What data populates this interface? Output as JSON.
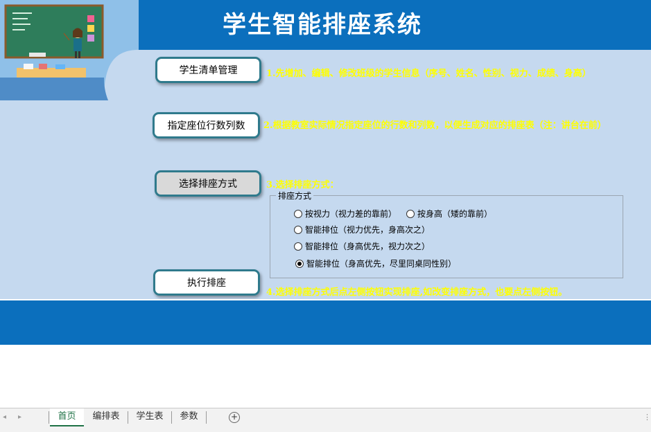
{
  "header": {
    "title": "学生智能排座系统"
  },
  "buttons": {
    "students": "学生清单管理",
    "seats": "指定座位行数列数",
    "method": "选择排座方式",
    "execute": "执行排座"
  },
  "steps": {
    "s1": "1.先增加、编辑、修改班级的学生信息（序号、姓名、性别、视力、成绩、身高）",
    "s2": "2.根据教室实际情况指定座位的行数和列数，以便生成对应的排座表（注：讲台在前）",
    "s3": "3.选择排座方式：",
    "s4": "4.选择排座方式后点左侧按钮实现排座,如改变排座方式，也要点左侧按钮。"
  },
  "seating": {
    "legend": "排座方式",
    "options": [
      {
        "label": "按视力（视力差的靠前）",
        "selected": false
      },
      {
        "label": "按身高（矮的靠前）",
        "selected": false
      },
      {
        "label": "智能排位（视力优先，身高次之）",
        "selected": false
      },
      {
        "label": "智能排位（身高优先，视力次之）",
        "selected": false
      },
      {
        "label": "智能排位（身高优先，尽里同桌同性别）",
        "selected": true
      }
    ]
  },
  "sheets": {
    "tabs": [
      "首页",
      "编排表",
      "学生表",
      "参数"
    ],
    "active": "首页"
  },
  "colors": {
    "banner": "#0b6fbd",
    "panel": "#c5d9ef",
    "step_text": "#ffff00",
    "active_tab": "#1e7145"
  }
}
